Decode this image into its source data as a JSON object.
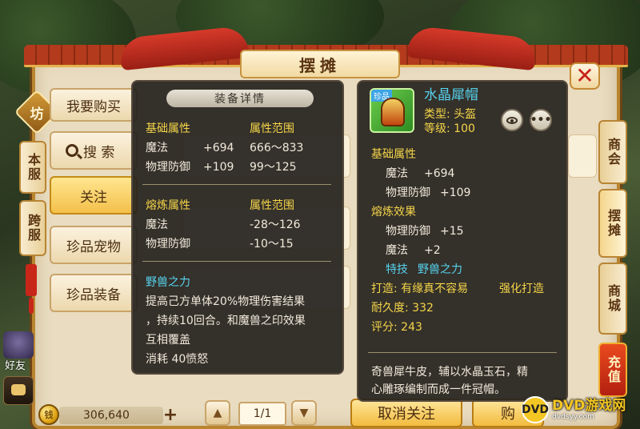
{
  "window": {
    "title": "摆摊",
    "close_symbol": "✕"
  },
  "left_tabs": {
    "emblem": "坊",
    "local_server": "本服",
    "cross_server": "跨服"
  },
  "left_menu": {
    "want_to_buy": "我要购买",
    "search": "搜 索",
    "follow": "关注",
    "rare_pets": "珍品宠物",
    "rare_equipment": "珍品装备"
  },
  "right_tabs": {
    "chamber": "商会",
    "stall": "摆摊",
    "mall": "商城",
    "recharge": "充值"
  },
  "sidebar": {
    "friends": "好友"
  },
  "bottom": {
    "coin_symbol": "钱",
    "coins": "306,640",
    "plus": "+",
    "page": "1/1",
    "unfollow_button": "取消关注",
    "buy_button": "购"
  },
  "detail_tooltip": {
    "header": "装备详情",
    "base_title": "基础属性",
    "base_range_title": "属性范围",
    "base_rows": [
      {
        "name": "魔法",
        "value": "+694",
        "range": "666～833"
      },
      {
        "name": "物理防御",
        "value": "+109",
        "range": "99～125"
      }
    ],
    "refine_title": "熔炼属性",
    "refine_range_title": "属性范围",
    "refine_rows": [
      {
        "name": "魔法",
        "range": "-28～126"
      },
      {
        "name": "物理防御",
        "range": "-10～15"
      }
    ],
    "skill_name": "野兽之力",
    "skill_desc_lines": [
      "提高己方单体20%物理伤害结果",
      "，持续10回合。和魔兽之印效果",
      "互相覆盖"
    ],
    "skill_cost": "消耗  40愤怒"
  },
  "item_tooltip": {
    "icon_tag": "珍品",
    "name": "水晶犀帽",
    "type": "类型: 头盔",
    "level": "等级: 100",
    "base_title": "基础属性",
    "base_rows": [
      {
        "name": "魔法",
        "value": "+694"
      },
      {
        "name": "物理防御",
        "value": "+109"
      }
    ],
    "refine_title": "熔炼效果",
    "refine_rows": [
      {
        "name": "物理防御",
        "value": "+15"
      },
      {
        "name": "魔法",
        "value": "+2"
      }
    ],
    "special_skill_label": "特技",
    "special_skill": "野兽之力",
    "forge": "打造: 有缘真不容易",
    "enhance": "强化打造",
    "durability": "耐久度: 332",
    "score": "评分: 243",
    "description_lines": [
      "奇兽犀牛皮，辅以水晶玉石，精",
      "心雕琢编制而成一件冠帽。"
    ]
  },
  "watermark": {
    "logo": "DVD",
    "name": "DVD游戏网",
    "url": "dvdsyy.com"
  },
  "colors": {
    "tooltip_bg": "#26221e",
    "highlight_yellow": "#f5d649",
    "highlight_cyan": "#56d3ee",
    "frame_gold": "#b9852f",
    "title_red": "#c8231a"
  }
}
